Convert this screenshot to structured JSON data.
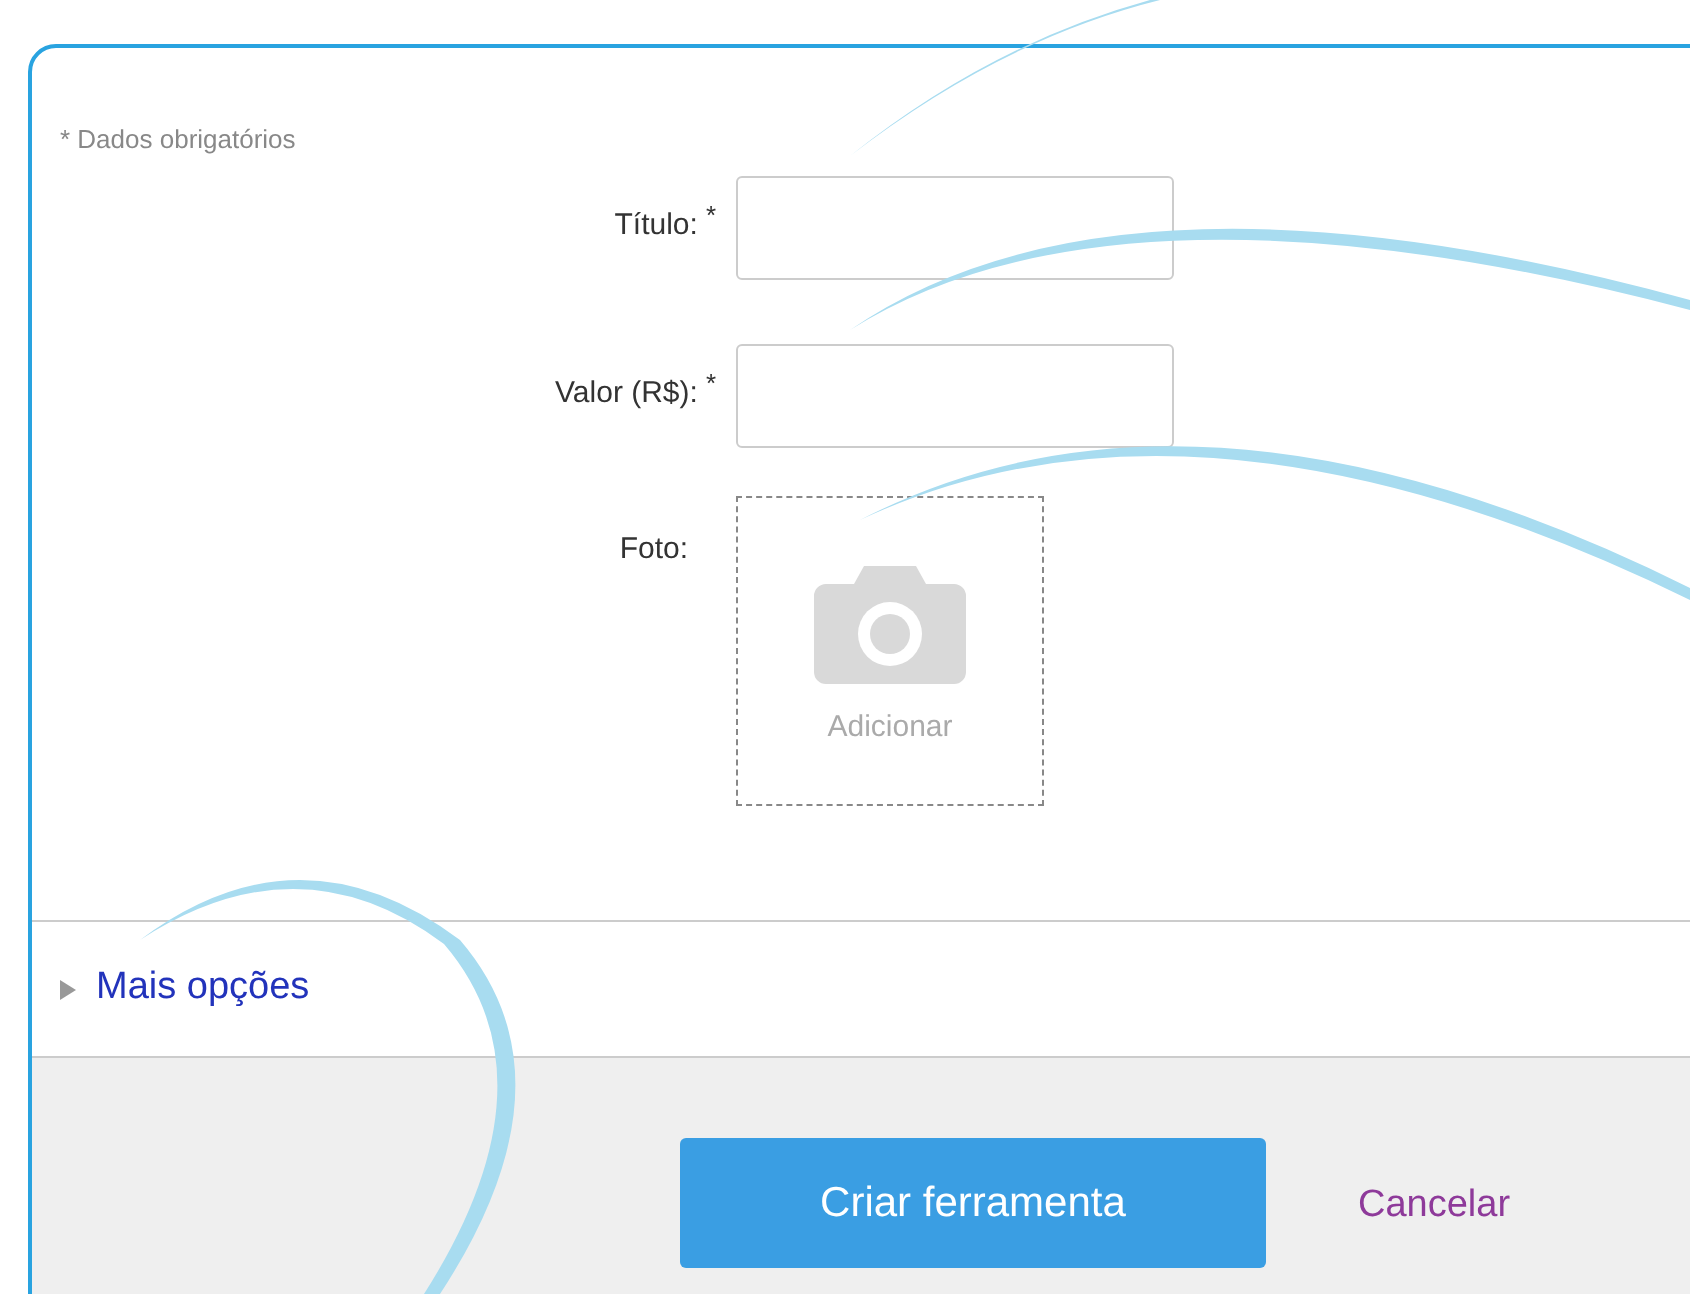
{
  "required_note": "* Dados obrigatórios",
  "fields": [
    {
      "label": "Título:",
      "required_mark": "*"
    },
    {
      "label": "Valor (R$):",
      "required_mark": "*"
    }
  ],
  "photo": {
    "label": "Foto:",
    "add_text": "Adicionar"
  },
  "more_options": {
    "label": "Mais opções",
    "expanded": false
  },
  "submit_button": "Criar ferramenta",
  "cancel_link": "Cancelar"
}
